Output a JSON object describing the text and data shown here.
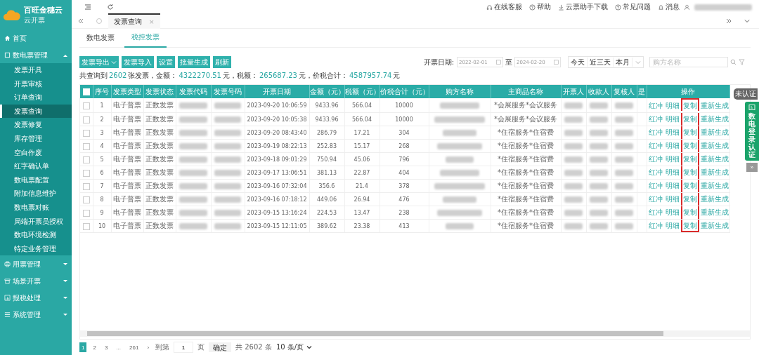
{
  "brand": {
    "name": "百旺金穗云",
    "subtitle": "云开票"
  },
  "sidebar": [
    {
      "label": "首页"
    },
    {
      "label": "数电票管理",
      "expanded": true,
      "children": [
        {
          "label": "发票开具",
          "selected": false
        },
        {
          "label": "开票审核",
          "selected": false
        },
        {
          "label": "订单查询",
          "selected": false
        },
        {
          "label": "发票查询",
          "selected": true
        },
        {
          "label": "发票修复",
          "selected": false
        },
        {
          "label": "库存管理",
          "selected": false
        },
        {
          "label": "空白作废",
          "selected": false
        },
        {
          "label": "红字确认单",
          "selected": false
        },
        {
          "label": "数电票配置",
          "selected": false
        },
        {
          "label": "附加信息维护",
          "selected": false
        },
        {
          "label": "数电票对账",
          "selected": false
        },
        {
          "label": "局端开票员授权",
          "selected": false
        },
        {
          "label": "数电环境检测",
          "selected": false
        },
        {
          "label": "特定业务管理",
          "selected": false
        }
      ]
    },
    {
      "label": "用票管理",
      "expanded": false
    },
    {
      "label": "场景开票",
      "expanded": false
    },
    {
      "label": "报税处理",
      "expanded": false
    },
    {
      "label": "系统管理",
      "expanded": false
    }
  ],
  "top_links": [
    {
      "label": "在线客服"
    },
    {
      "label": "帮助"
    },
    {
      "label": "云票助手下载"
    },
    {
      "label": "常见问题"
    },
    {
      "label": "消息"
    }
  ],
  "page_tabs": [
    {
      "label": "发票查询",
      "close": "×",
      "selected": true
    }
  ],
  "sub_tabs": [
    {
      "label": "数电发票",
      "selected": false
    },
    {
      "label": "税控发票",
      "selected": true
    }
  ],
  "toolbar": [
    {
      "label": "发票导出",
      "dropdown": true
    },
    {
      "label": "发票导入",
      "dropdown": false
    },
    {
      "label": "设置",
      "dropdown": false
    },
    {
      "label": "批量生成",
      "dropdown": false
    },
    {
      "label": "刷新",
      "dropdown": false
    }
  ],
  "summary": [
    {
      "label": "共查询到",
      "value": "2602",
      "unit": "张发票，"
    },
    {
      "label": "金额：",
      "value": "4322270.51",
      "unit": "元，"
    },
    {
      "label": "税额：",
      "value": "265687.23",
      "unit": "元，"
    },
    {
      "label": "价税合计：",
      "value": "4587957.74",
      "unit": "元"
    }
  ],
  "filter": {
    "label": "开票日期:",
    "start": "2022-02-01",
    "to": "至",
    "end": "2024-02-20",
    "quick": [
      "今天",
      "近三天",
      "本月"
    ],
    "search_placeholder": "购方名称"
  },
  "table": {
    "all_checked": false,
    "columns": [
      {
        "label": "序号",
        "kind": "text"
      },
      {
        "label": "发票类型",
        "kind": "text"
      },
      {
        "label": "发票状态",
        "kind": "text"
      },
      {
        "label": "发票代码",
        "kind": "blurred"
      },
      {
        "label": "发票号码",
        "kind": "blurred"
      },
      {
        "label": "开票日期",
        "kind": "text"
      },
      {
        "label": "金额（元）",
        "kind": "text"
      },
      {
        "label": "税额（元）",
        "kind": "text"
      },
      {
        "label": "价税合计（元）",
        "kind": "text"
      },
      {
        "label": "购方名称",
        "kind": "blurred"
      },
      {
        "label": "主商品名称",
        "kind": "text"
      },
      {
        "label": "开票人",
        "kind": "blurred"
      },
      {
        "label": "收款人",
        "kind": "blurred"
      },
      {
        "label": "复核人",
        "kind": "blurred"
      },
      {
        "label": "是",
        "kind": "text"
      },
      {
        "label": "操作",
        "kind": "actions"
      }
    ],
    "action_slots": [
      {
        "highlighted": false
      },
      {
        "highlighted": false
      },
      {
        "highlighted": true
      },
      {
        "highlighted": false
      }
    ],
    "rows": [
      {
        "checked": false,
        "cells": [
          "1",
          "电子普票",
          "正数发票",
          "",
          "",
          "2023-09-20 10:06:59",
          "9433.96",
          "566.04",
          "10000",
          "",
          "*会展服务*会议服务",
          "",
          "",
          "",
          ""
        ],
        "actions": [
          "红冲",
          "明细",
          "复制",
          "重新生成"
        ]
      },
      {
        "checked": false,
        "cells": [
          "2",
          "电子普票",
          "正数发票",
          "",
          "",
          "2023-09-20 10:05:38",
          "9433.96",
          "566.04",
          "10000",
          "",
          "*会展服务*会议服务",
          "",
          "",
          "",
          ""
        ],
        "actions": [
          "红冲",
          "明细",
          "复制",
          "重新生成"
        ]
      },
      {
        "checked": false,
        "cells": [
          "3",
          "电子普票",
          "正数发票",
          "",
          "",
          "2023-09-20 08:43:40",
          "286.79",
          "17.21",
          "304",
          "",
          "*住宿服务*住宿费",
          "",
          "",
          "",
          ""
        ],
        "actions": [
          "红冲",
          "明细",
          "复制",
          "重新生成"
        ]
      },
      {
        "checked": false,
        "cells": [
          "4",
          "电子普票",
          "正数发票",
          "",
          "",
          "2023-09-19 08:22:13",
          "252.83",
          "15.17",
          "268",
          "",
          "*住宿服务*住宿费",
          "",
          "",
          "",
          ""
        ],
        "actions": [
          "红冲",
          "明细",
          "复制",
          "重新生成"
        ]
      },
      {
        "checked": false,
        "cells": [
          "5",
          "电子普票",
          "正数发票",
          "",
          "",
          "2023-09-18 09:01:29",
          "750.94",
          "45.06",
          "796",
          "",
          "*住宿服务*住宿费",
          "",
          "",
          "",
          ""
        ],
        "actions": [
          "红冲",
          "明细",
          "复制",
          "重新生成"
        ]
      },
      {
        "checked": false,
        "cells": [
          "6",
          "电子普票",
          "正数发票",
          "",
          "",
          "2023-09-17 13:06:51",
          "381.13",
          "22.87",
          "404",
          "",
          "*住宿服务*住宿费",
          "",
          "",
          "",
          ""
        ],
        "actions": [
          "红冲",
          "明细",
          "复制",
          "重新生成"
        ]
      },
      {
        "checked": false,
        "cells": [
          "7",
          "电子普票",
          "正数发票",
          "",
          "",
          "2023-09-16 07:32:04",
          "356.6",
          "21.4",
          "378",
          "",
          "*住宿服务*住宿费",
          "",
          "",
          "",
          ""
        ],
        "actions": [
          "红冲",
          "明细",
          "复制",
          "重新生成"
        ]
      },
      {
        "checked": false,
        "cells": [
          "8",
          "电子普票",
          "正数发票",
          "",
          "",
          "2023-09-16 07:18:12",
          "449.06",
          "26.94",
          "476",
          "",
          "*住宿服务*住宿费",
          "",
          "",
          "",
          ""
        ],
        "actions": [
          "红冲",
          "明细",
          "复制",
          "重新生成"
        ]
      },
      {
        "checked": false,
        "cells": [
          "9",
          "电子普票",
          "正数发票",
          "",
          "",
          "2023-09-15 13:16:24",
          "224.53",
          "13.47",
          "238",
          "",
          "*住宿服务*住宿费",
          "",
          "",
          "",
          ""
        ],
        "actions": [
          "红冲",
          "明细",
          "复制",
          "重新生成"
        ]
      },
      {
        "checked": false,
        "cells": [
          "10",
          "电子普票",
          "正数发票",
          "",
          "",
          "2023-09-15 12:11:05",
          "389.62",
          "23.38",
          "413",
          "",
          "*住宿服务*住宿费",
          "",
          "",
          "",
          ""
        ],
        "actions": [
          "红冲",
          "明细",
          "复制",
          "重新生成"
        ]
      }
    ]
  },
  "pagination": {
    "pages": [
      {
        "label": "1",
        "selected": true
      },
      {
        "label": "2",
        "selected": false
      },
      {
        "label": "3",
        "selected": false
      },
      {
        "label": "...",
        "selected": false
      },
      {
        "label": "261",
        "selected": false
      }
    ],
    "next": "›",
    "goto": "到第",
    "page": "1",
    "page_unit": "页",
    "confirm": "确定",
    "total": "共 2602 条",
    "size": "10 条/页"
  },
  "side_panel": {
    "badge": "未认证",
    "label": "数电登录认证",
    "collapse": "»"
  }
}
